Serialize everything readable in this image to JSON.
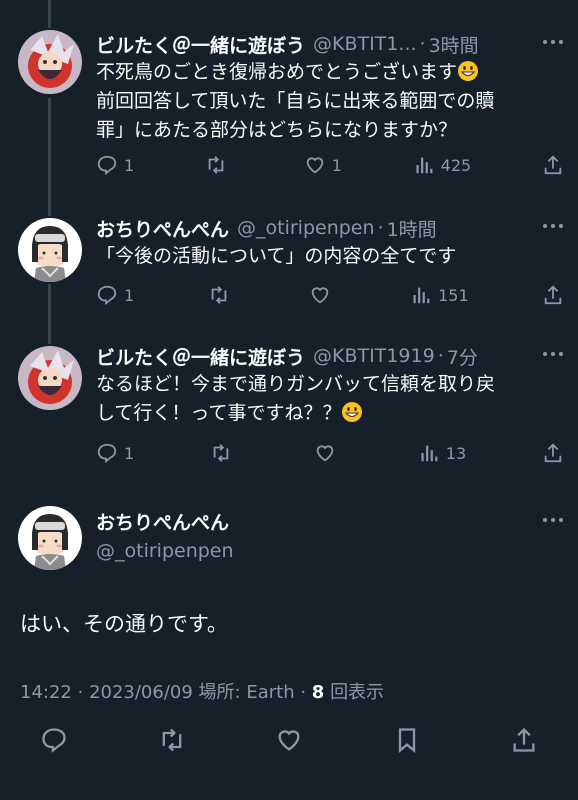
{
  "tweets": [
    {
      "name": "ビルたく＠一緒に遊ぼう",
      "handle": "@KBTIT1...",
      "time": "3時間",
      "text_line1": "不死鳥のごとき復帰おめでとうございます",
      "text_line2": "前回回答して頂いた「自らに出来る範囲での贖",
      "text_line3": "罪」にあたる部分はどちらになりますか？",
      "replies": "1",
      "retweets": "",
      "likes": "1",
      "views": "425"
    },
    {
      "name": "おちりぺんぺん",
      "handle": "@_otiripenpen",
      "time": "1時間",
      "text_line1": "「今後の活動について」の内容の全てです",
      "replies": "1",
      "retweets": "",
      "likes": "",
      "views": "151"
    },
    {
      "name": "ビルたく＠一緒に遊ぼう",
      "handle": "@KBTIT1919",
      "time": "7分",
      "text_line1": "なるほど！今まで通りガンバッて信頼を取り戻",
      "text_line2": "して行く！って事ですね？？",
      "replies": "1",
      "retweets": "",
      "likes": "",
      "views": "13"
    }
  ],
  "main_tweet": {
    "name": "おちりぺんぺん",
    "handle": "@_otiripenpen",
    "text": "はい、その通りです。",
    "time": "14:22",
    "date": "2023/06/09",
    "location": "場所: Earth",
    "views_count": "8",
    "views_label": "回表示"
  },
  "icons": [
    "reply-icon",
    "retweet-icon",
    "like-icon",
    "views-icon",
    "share-icon",
    "more-icon",
    "grinning-emoji"
  ],
  "colors": {
    "background": "#15202b",
    "text": "#f7f9f9",
    "muted": "#8b98a5",
    "thread": "#38444d"
  }
}
